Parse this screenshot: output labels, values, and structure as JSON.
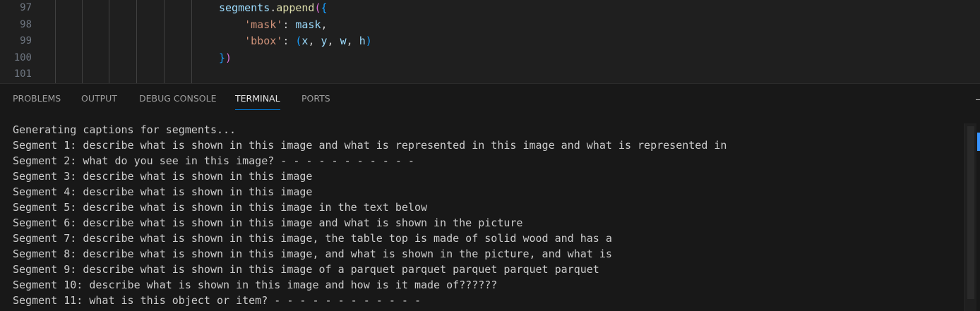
{
  "editor": {
    "lines": [
      {
        "number": "97",
        "parts": [
          {
            "cls": "tok-var",
            "text": "segments"
          },
          {
            "cls": "tok-punc",
            "text": "."
          },
          {
            "cls": "tok-fn",
            "text": "append"
          },
          {
            "cls": "tok-brace",
            "text": "("
          },
          {
            "cls": "tok-paren",
            "text": "{"
          }
        ]
      },
      {
        "number": "98",
        "parts": [
          {
            "cls": "tok-punc",
            "text": "    "
          },
          {
            "cls": "tok-str",
            "text": "'mask'"
          },
          {
            "cls": "tok-punc",
            "text": ": "
          },
          {
            "cls": "tok-var",
            "text": "mask"
          },
          {
            "cls": "tok-punc",
            "text": ","
          }
        ]
      },
      {
        "number": "99",
        "parts": [
          {
            "cls": "tok-punc",
            "text": "    "
          },
          {
            "cls": "tok-str",
            "text": "'bbox'"
          },
          {
            "cls": "tok-punc",
            "text": ": "
          },
          {
            "cls": "tok-paren",
            "text": "("
          },
          {
            "cls": "tok-var",
            "text": "x"
          },
          {
            "cls": "tok-punc",
            "text": ", "
          },
          {
            "cls": "tok-var",
            "text": "y"
          },
          {
            "cls": "tok-punc",
            "text": ", "
          },
          {
            "cls": "tok-var",
            "text": "w"
          },
          {
            "cls": "tok-punc",
            "text": ", "
          },
          {
            "cls": "tok-var",
            "text": "h"
          },
          {
            "cls": "tok-paren",
            "text": ")"
          }
        ]
      },
      {
        "number": "100",
        "parts": [
          {
            "cls": "tok-paren",
            "text": "}"
          },
          {
            "cls": "tok-brace",
            "text": ")"
          }
        ]
      },
      {
        "number": "101",
        "parts": []
      }
    ]
  },
  "panel": {
    "tabs": [
      {
        "label": "PROBLEMS",
        "active": false
      },
      {
        "label": "OUTPUT",
        "active": false
      },
      {
        "label": "DEBUG CONSOLE",
        "active": false
      },
      {
        "label": "TERMINAL",
        "active": true
      },
      {
        "label": "PORTS",
        "active": false
      }
    ]
  },
  "terminal": {
    "lines": [
      "Generating captions for segments...",
      "Segment 1: describe what is shown in this image and what is represented in this image and what is represented in",
      "Segment 2: what do you see in this image? - - - - - - - - - - -",
      "Segment 3: describe what is shown in this image",
      "Segment 4: describe what is shown in this image",
      "Segment 5: describe what is shown in this image in the text below",
      "Segment 6: describe what is shown in this image and what is shown in the picture",
      "Segment 7: describe what is shown in this image, the table top is made of solid wood and has a",
      "Segment 8: describe what is shown in this image, and what is shown in the picture, and what is",
      "Segment 9: describe what is shown in this image of a parquet parquet parquet parquet parquet",
      "Segment 10: describe what is shown in this image and how is it made of??????",
      "Segment 11: what is this object or item? - - - - - - - - - - - -"
    ]
  }
}
